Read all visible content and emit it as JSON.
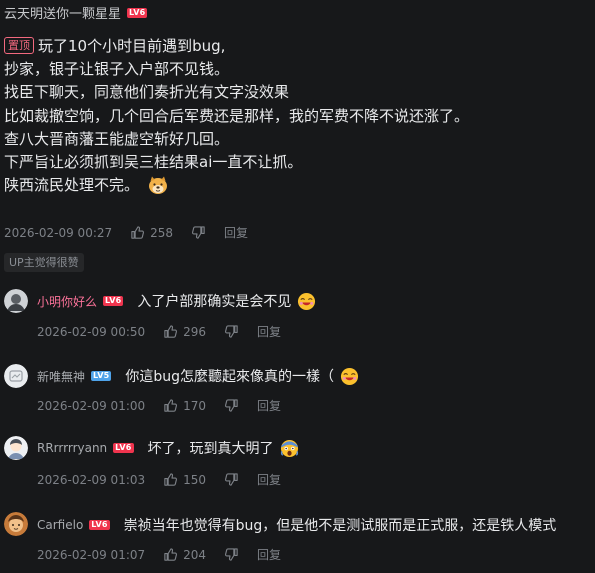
{
  "main_comment": {
    "username": "云天明送你一颗星星",
    "level": "LV6",
    "pin_label": "置顶",
    "lines": [
      "玩了10个小时目前遇到bug,",
      "抄家，银子让银子入户部不见钱。",
      "找臣下聊天，同意他们奏折光有文字没效果",
      "比如裁撤空饷，几个回合后军费还是那样，我的军费不降不说还涨了。",
      "查八大晋商藩王能虚空斩好几回。",
      "下严旨让必须抓到吴三桂结果ai一直不让抓。",
      "陕西流民处理不完。"
    ],
    "date": "2026-02-09 00:27",
    "likes": "258",
    "reply_label": "回复"
  },
  "up_liked_label": "UP主觉得很赞",
  "replies": [
    {
      "username": "小明你好么",
      "level": "LV6",
      "text": "入了户部那确实是会不见",
      "date": "2026-02-09 00:50",
      "likes": "296",
      "reply_label": "回复"
    },
    {
      "username": "新唯無神",
      "level": "LV5",
      "text": "你這bug怎麼聽起來像真的一樣（",
      "date": "2026-02-09 01:00",
      "likes": "170",
      "reply_label": "回复"
    },
    {
      "username": "RRrrrrryann",
      "level": "LV6",
      "text": "坏了，玩到真大明了",
      "date": "2026-02-09 01:03",
      "likes": "150",
      "reply_label": "回复"
    },
    {
      "username": "Carfielo",
      "level": "LV6",
      "text": "崇祯当年也觉得有bug，但是他不是测试服而是正式服，还是铁人模式",
      "date": "2026-02-09 01:07",
      "likes": "204",
      "reply_label": "回复"
    }
  ],
  "colors": {
    "background": "#17181a",
    "username_pink": "#fb7299",
    "level_red": "#f0344e",
    "level_blue": "#4fa3ea",
    "meta_gray": "#7d8187"
  },
  "icons": [
    "thumbs-up-icon",
    "thumbs-down-icon",
    "doge-emoji",
    "laughing-emoji",
    "scared-emoji"
  ]
}
